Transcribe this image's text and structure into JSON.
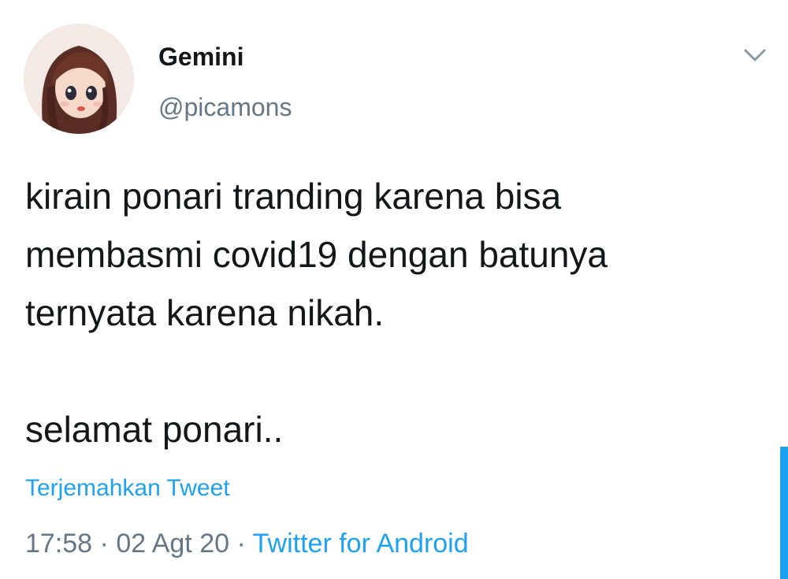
{
  "tweet": {
    "author": {
      "display_name": "Gemini",
      "handle": "@picamons"
    },
    "text_lines": [
      "kirain ponari tranding karena bisa",
      "membasmi covid19 dengan batunya",
      "ternyata karena nikah."
    ],
    "text_after_break": "selamat ponari..",
    "translate_label": "Terjemahkan Tweet",
    "time": "17:58",
    "separator": "·",
    "date": "02 Agt 20",
    "source": "Twitter for Android"
  },
  "colors": {
    "accent": "#1da1f2",
    "text_primary": "#14171a",
    "text_secondary": "#657786"
  },
  "icons": {
    "avatar": "cartoon-girl-avatar",
    "caret": "chevron-down-icon"
  }
}
